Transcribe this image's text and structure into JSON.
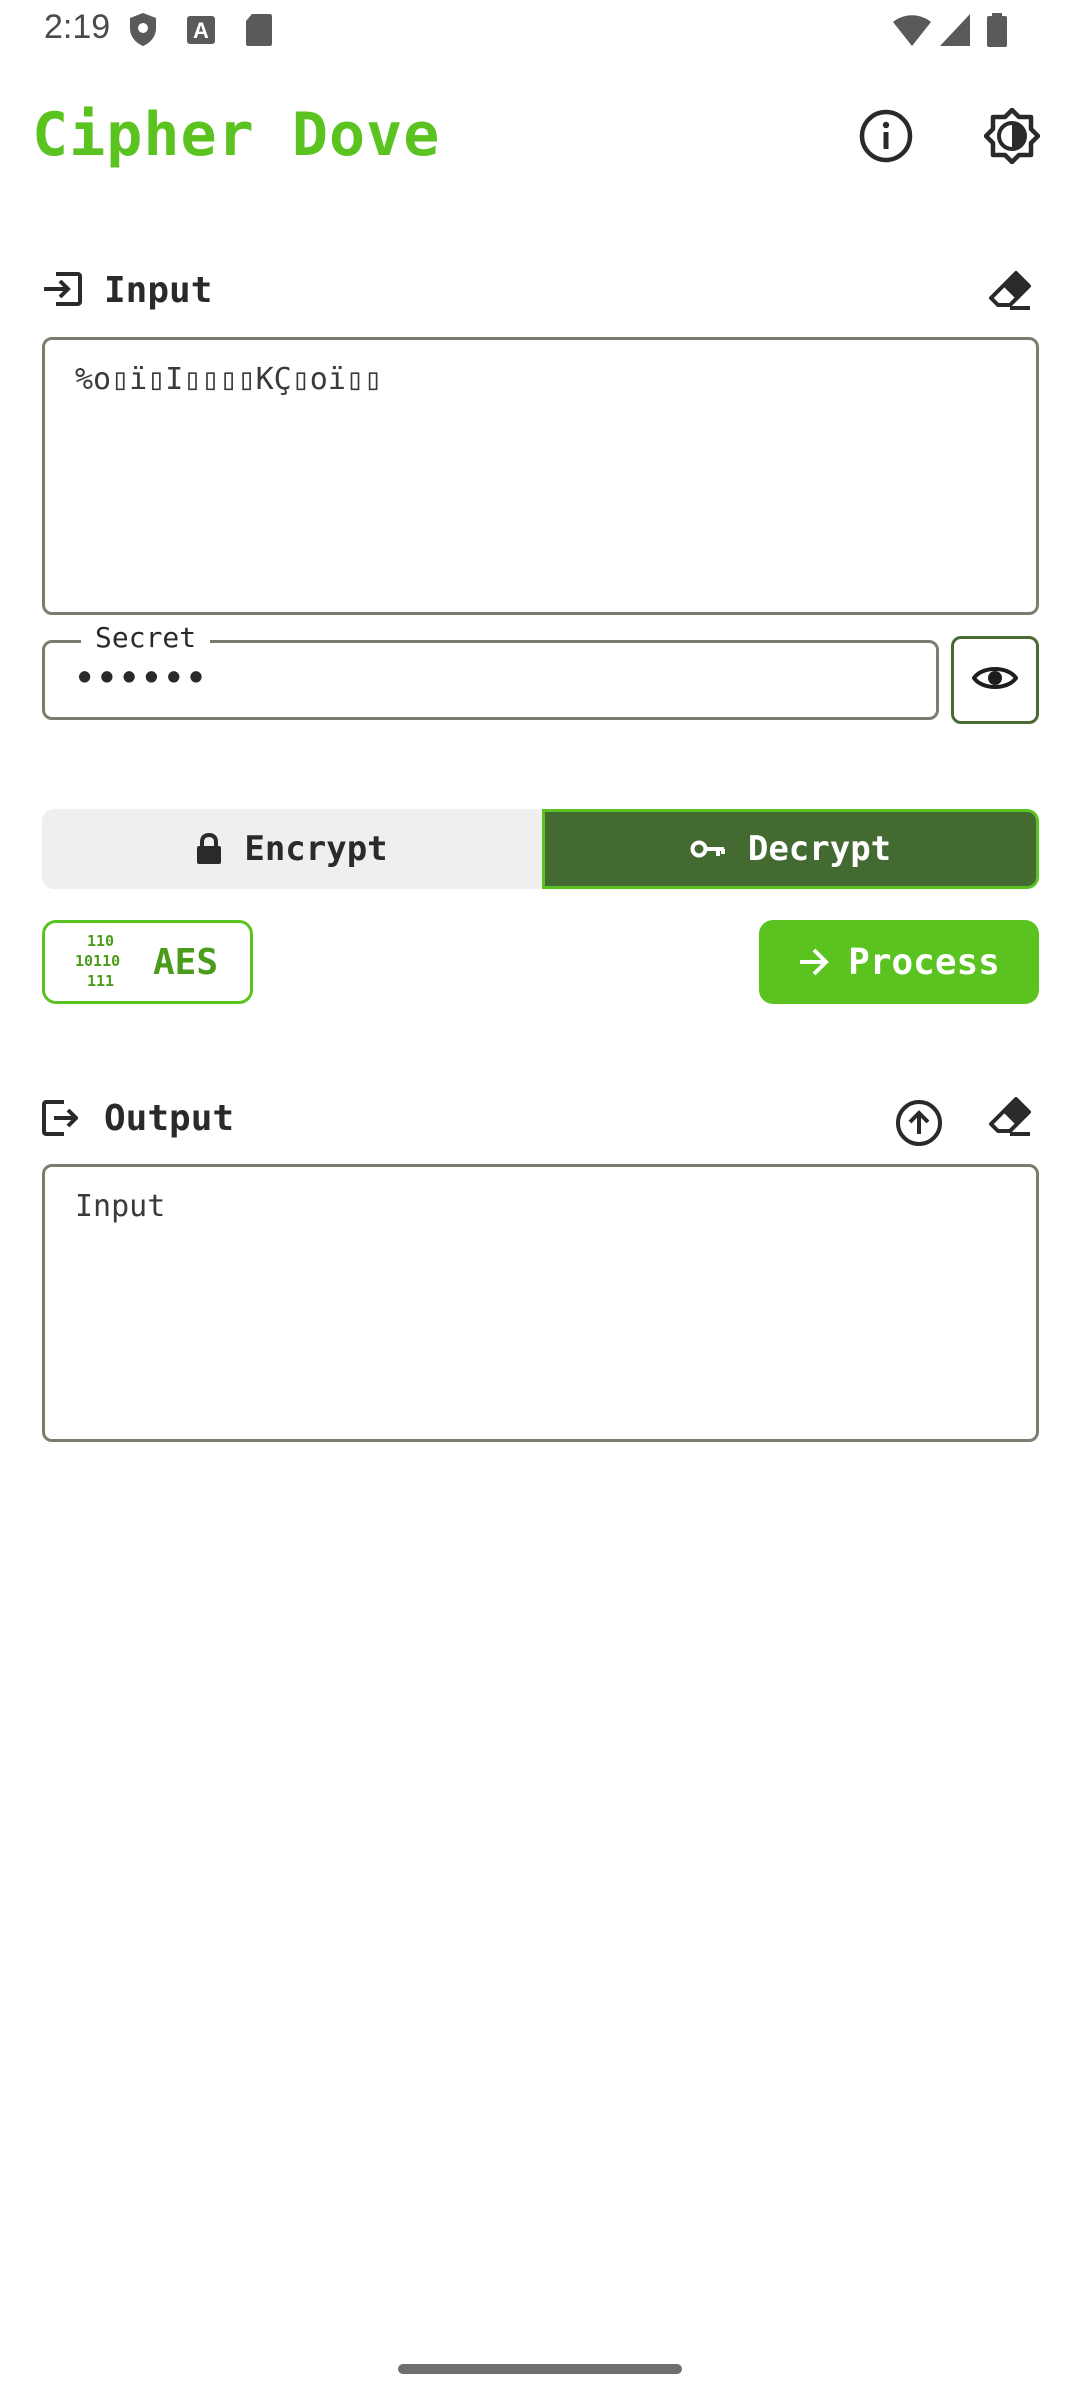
{
  "status_bar": {
    "time": "2:19",
    "icons": [
      "shield-icon",
      "font-a-icon",
      "sd-card-icon",
      "wifi-icon",
      "signal-icon",
      "battery-icon"
    ]
  },
  "app_bar": {
    "title": "Cipher Dove",
    "actions": [
      "info-icon",
      "brightness-icon"
    ]
  },
  "input_section": {
    "label": "Input",
    "value": "%o▯ï▯I▯▯▯▯KÇ▯oï▯▯"
  },
  "secret": {
    "label": "Secret",
    "value": "••••••"
  },
  "mode": {
    "options": [
      {
        "label": "Encrypt",
        "icon": "lock-icon",
        "selected": false
      },
      {
        "label": "Decrypt",
        "icon": "key-icon",
        "selected": true
      }
    ]
  },
  "algorithm": {
    "label": "AES",
    "icon": "binary-icon"
  },
  "process": {
    "label": "Process",
    "icon": "arrow-right-icon"
  },
  "output_section": {
    "label": "Output",
    "value": "Input"
  },
  "colors": {
    "accent": "#5ac31f",
    "selected_segment": "#436a30",
    "border": "#7c7c6f"
  }
}
